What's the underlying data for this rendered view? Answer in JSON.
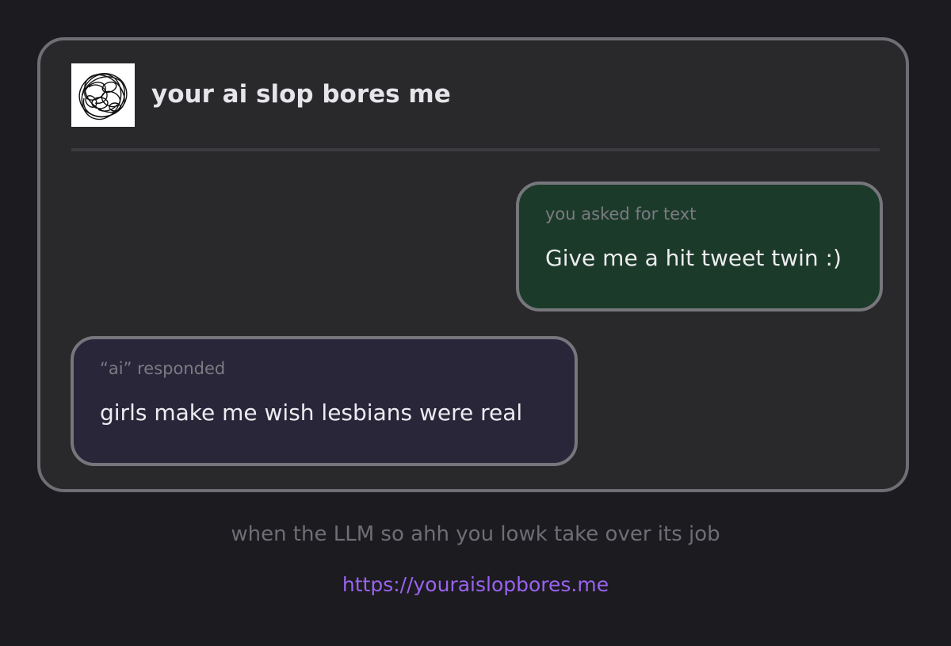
{
  "header": {
    "title": "your ai slop bores me",
    "logo_icon": "scribble-ball-icon"
  },
  "messages": [
    {
      "label": "you asked for text",
      "text": "Give me a hit tweet twin :)"
    },
    {
      "label": "“ai” responded",
      "text": "girls make me wish lesbians were real"
    }
  ],
  "footer": {
    "caption": "when the LLM so ahh you lowk take over its job",
    "link": "https://youraislopbores.me"
  },
  "colors": {
    "background": "#1c1b20",
    "card": "#29292b",
    "user_bubble": "#1c3a2a",
    "ai_bubble": "#29263a",
    "link": "#9a63f0"
  }
}
